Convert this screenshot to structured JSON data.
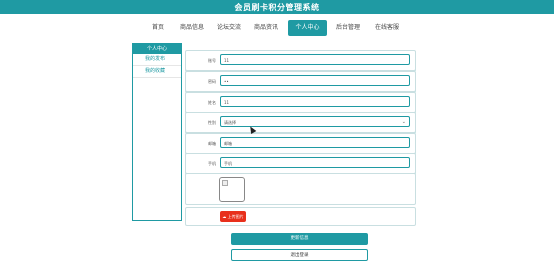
{
  "header": {
    "title": "会员刷卡积分管理系统"
  },
  "nav": {
    "items": [
      {
        "label": "首页"
      },
      {
        "label": "商品信息"
      },
      {
        "label": "论坛交流"
      },
      {
        "label": "商品资讯"
      },
      {
        "label": "个人中心",
        "active": true
      },
      {
        "label": "后台管理"
      },
      {
        "label": "在线客服"
      }
    ]
  },
  "sidebar": {
    "title": "个人中心",
    "items": [
      {
        "label": "我的发布"
      },
      {
        "label": "我的收藏"
      }
    ]
  },
  "form": {
    "fields": [
      {
        "label": "账号",
        "value": "11"
      },
      {
        "label": "密码",
        "value": "••"
      },
      {
        "label": "姓名",
        "value": "11"
      },
      {
        "label": "性别",
        "value": "请选择"
      },
      {
        "label": "邮箱",
        "value": "邮箱"
      },
      {
        "label": "手机",
        "value": "手机"
      }
    ],
    "upload_label": "上传图片"
  },
  "actions": {
    "update_label": "更新信息",
    "logout_label": "退出登录"
  },
  "colors": {
    "brand": "#1f9aa3",
    "danger": "#e8301c"
  }
}
